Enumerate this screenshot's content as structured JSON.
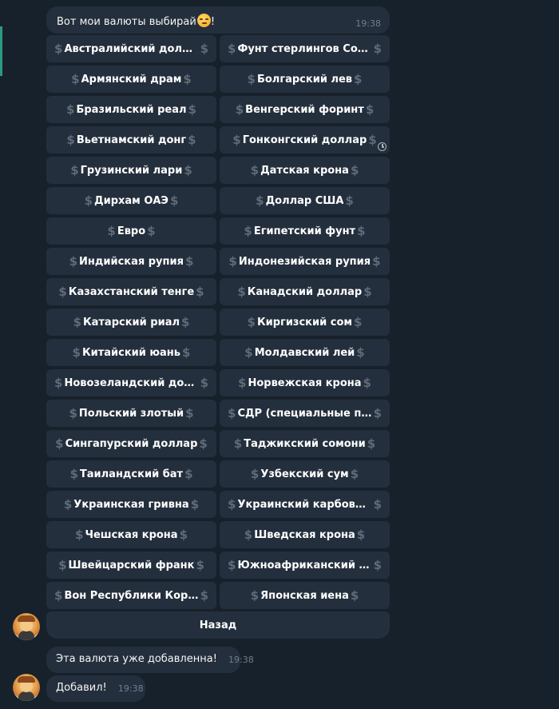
{
  "top_message": {
    "text": "Вот мои валюты выбирай",
    "trailing": "!",
    "time": "19:38"
  },
  "icons": {
    "currency": "dollar-icon",
    "pending": "clock-icon",
    "emoji": "smirk-emoji"
  },
  "keyboard": {
    "dollar_glyph": "$",
    "rows": [
      [
        "Австралийский доллар",
        "Фунт стерлингов Соедин…"
      ],
      [
        "Армянский драм",
        "Болгарский лев"
      ],
      [
        "Бразильский реал",
        "Венгерский форинт"
      ],
      [
        "Вьетнамский донг",
        "Гонконгский доллар"
      ],
      [
        "Грузинский лари",
        "Датская крона"
      ],
      [
        "Дирхам ОАЭ",
        "Доллар США"
      ],
      [
        "Евро",
        "Египетский фунт"
      ],
      [
        "Индийская рупия",
        "Индонезийская рупия"
      ],
      [
        "Казахстанский тенге",
        "Канадский доллар"
      ],
      [
        "Катарский риал",
        "Киргизский сом"
      ],
      [
        "Китайский юань",
        "Молдавский лей"
      ],
      [
        "Новозеландский доллар…",
        "Норвежская крона"
      ],
      [
        "Польский злотый",
        "СДР (специальные прав…"
      ],
      [
        "Сингапурский доллар",
        "Таджикский сомони"
      ],
      [
        "Таиландский бат",
        "Узбекский сум"
      ],
      [
        "Украинская гривна",
        "Украинский карбованец…"
      ],
      [
        "Чешская крона",
        "Шведская крона"
      ],
      [
        "Швейцарский франк",
        "Южноафриканский рэн…"
      ],
      [
        "Вон Республики Корея",
        "Японская иена"
      ]
    ],
    "back_label": "Назад"
  },
  "messages": [
    {
      "text": "Эта валюта уже добавленна!",
      "time": "19:38"
    },
    {
      "text": "Добавил!",
      "time": "19:38"
    }
  ],
  "colors": {
    "background": "#17212b",
    "bubble": "#242f3d",
    "accent": "#2b9b7e",
    "muted": "#6d7f8f"
  }
}
